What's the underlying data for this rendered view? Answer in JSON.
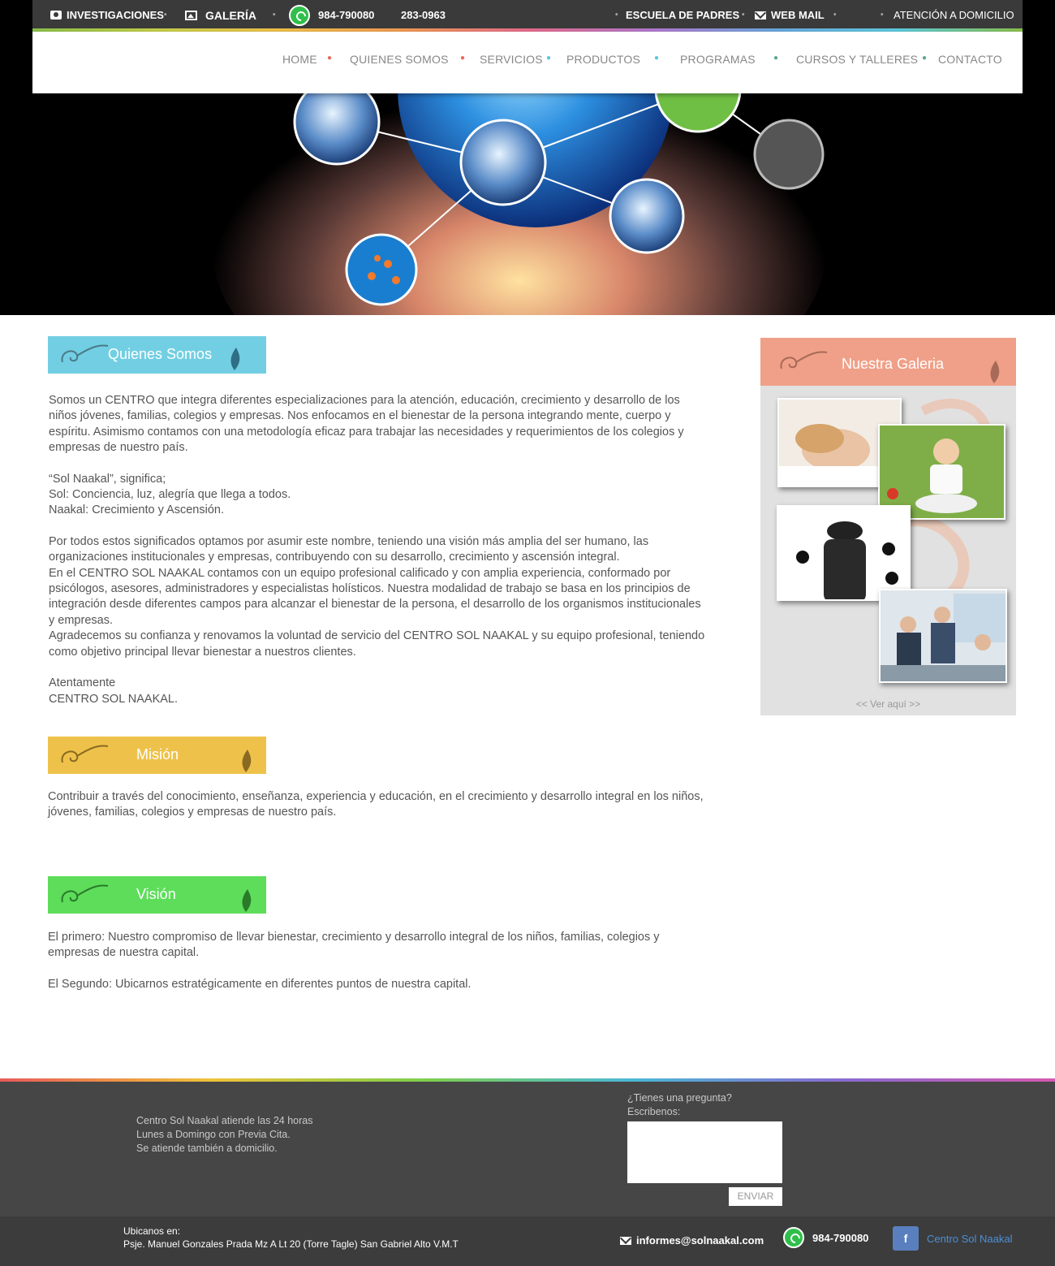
{
  "topbar": {
    "investigaciones": "INVESTIGACIONES",
    "galeria": "GALERÍA",
    "phone1": "984-790080",
    "phone2": "283-0963",
    "escuela": "ESCUELA DE PADRES",
    "webmail": "WEB MAIL",
    "atencion": "ATENCIÓN A DOMICILIO"
  },
  "nav": {
    "home": "HOME",
    "quienes": "QUIENES SOMOS",
    "servicios": "SERVICIOS",
    "productos": "PRODUCTOS",
    "programas": "PROGRAMAS",
    "cursos": "CURSOS Y TALLERES",
    "contacto": "CONTACTO"
  },
  "quienes": {
    "title": "Quienes Somos",
    "p1": "Somos un CENTRO que integra diferentes especializaciones para la atención, educación, crecimiento y desarrollo de los niños jóvenes, familias, colegios y empresas. Nos enfocamos en el bienestar de la persona integrando mente, cuerpo y espíritu. Asimismo contamos con una metodología eficaz  para  trabajar las necesidades y requerimientos de los colegios y empresas de nuestro país.",
    "p2a": "“Sol Naakal”, significa;",
    "p2b": "Sol: Conciencia, luz,  alegría que llega a todos.",
    "p2c": "Naakal: Crecimiento y Ascensión.",
    "p3": "Por todos estos significados optamos por asumir este nombre, teniendo una visión más amplia del ser humano, las organizaciones institucionales y empresas, contribuyendo con su desarrollo, crecimiento y ascensión integral.",
    "p4": "En el CENTRO SOL NAAKAL contamos con un equipo profesional  calificado y con amplia experiencia, conformado por psicólogos, asesores, administradores y especialistas holísticos. Nuestra modalidad de trabajo se basa en los principios de integración desde diferentes campos para alcanzar el bienestar de la persona, el desarrollo de los organismos institucionales y empresas.",
    "p5": "Agradecemos su confianza y renovamos la voluntad de servicio del CENTRO SOL NAAKAL y su equipo profesional, teniendo como objetivo principal llevar bienestar a nuestros clientes.",
    "sign1": "Atentamente",
    "sign2": "CENTRO SOL NAAKAL."
  },
  "mision": {
    "title": "Misión",
    "text": "Contribuir a través del conocimiento, enseñanza, experiencia y educación, en el crecimiento y desarrollo integral en los niños, jóvenes,  familias, colegios y empresas de nuestro país."
  },
  "vision": {
    "title": "Visión",
    "p1": "El primero: Nuestro compromiso de llevar bienestar, crecimiento y desarrollo integral de los niños, familias, colegios y empresas de nuestra capital.",
    "p2": "El Segundo: Ubicarnos estratégicamente en diferentes puntos de nuestra capital."
  },
  "gallery": {
    "title": "Nuestra Galeria",
    "link": "<< Ver aquí >>"
  },
  "footer": {
    "hours1": "Centro Sol Naakal atiende las 24 horas",
    "hours2": "Lunes a Domingo con Previa Cita.",
    "hours3": "Se atiende también a domicilio.",
    "ask1": "¿Tienes una pregunta?",
    "ask2": "Escribenos:",
    "send": "ENVIAR",
    "loc1": "Ubicanos en:",
    "loc2": "Psje. Manuel Gonzales Prada Mz A Lt 20 (Torre Tagle) San Gabriel Alto V.M.T",
    "email": "informes@solnaakal.com",
    "phone": "984-790080",
    "facebook": "Centro Sol Naakal"
  },
  "colors": {
    "quienes": "#72cfe3",
    "mision": "#eec24a",
    "vision": "#5ddd5a",
    "gallery": "#f0a088"
  },
  "icons": [
    "camera-icon",
    "image-icon",
    "whatsapp-icon",
    "mail-icon",
    "facebook-icon"
  ]
}
